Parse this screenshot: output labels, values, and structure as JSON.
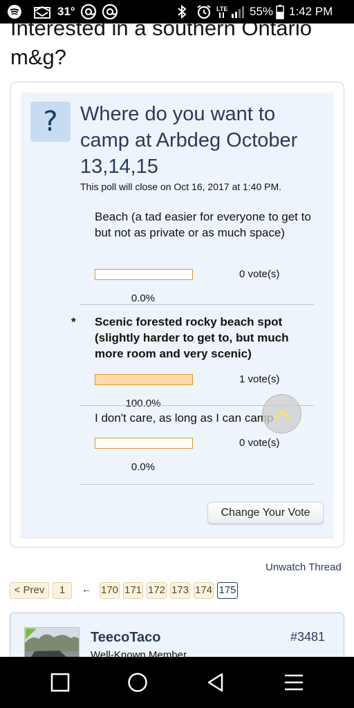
{
  "status_bar": {
    "temperature": "31°",
    "battery": "55%",
    "time": "1:42 PM",
    "network": "LTE"
  },
  "thread": {
    "title": "Interested in a southern Ontario m&g?"
  },
  "poll": {
    "question": "Where do you want to camp at Arbdeg October 13,14,15",
    "close_text": "This poll will close on Oct 16, 2017 at 1:40 PM.",
    "options": [
      {
        "label": "Beach (a tad easier for everyone to get to but not as private or as much space)",
        "votes": "0 vote(s)",
        "percent": "0.0%",
        "fraction": 0.0,
        "selected": false
      },
      {
        "label": "Scenic forested rocky beach spot (slightly harder to get to, but much more room and very scenic)",
        "votes": "1 vote(s)",
        "percent": "100.0%",
        "fraction": 1.0,
        "selected": true,
        "marker": "*"
      },
      {
        "label": "I don't care, as long as I can camp",
        "votes": "0 vote(s)",
        "percent": "0.0%",
        "fraction": 0.0,
        "selected": false
      }
    ],
    "change_vote_label": "Change Your Vote"
  },
  "unwatch_label": "Unwatch Thread",
  "pagination": {
    "prev_label": "< Prev",
    "first_page": "1",
    "ellipsis": "←",
    "pages": [
      "170",
      "171",
      "172",
      "173",
      "174",
      "175"
    ],
    "current": "175"
  },
  "post": {
    "username": "TeecoTaco",
    "user_title": "Well-Known Member",
    "post_number": "#3481"
  },
  "colors": {
    "accent_text": "#2a3b56",
    "poll_bg": "#eef4fb",
    "bar_border": "#d89a2e",
    "bar_fill": "#fdd9a5",
    "pager_bg": "#fbf3e2"
  }
}
